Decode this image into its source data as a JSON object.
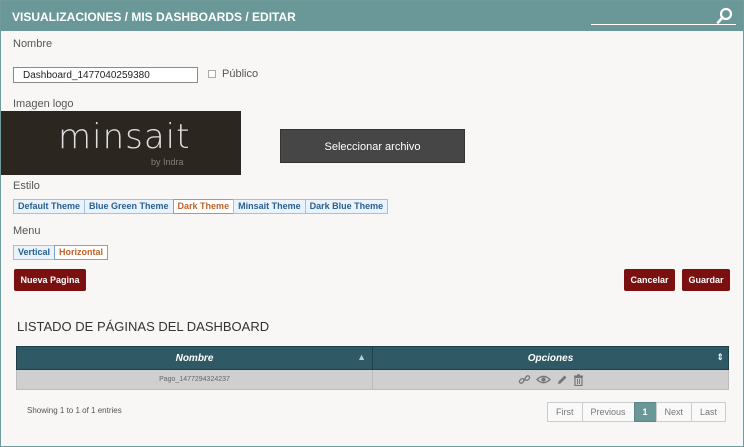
{
  "titlebar": {
    "title": "VISUALIZACIONES / MIS DASHBOARDS / EDITAR",
    "search_placeholder": ""
  },
  "form": {
    "name_label": "Nombre",
    "name_value": "Dashboard_1477040259380",
    "public_label": "Público",
    "logo_label": "Imagen logo",
    "logo_text": "minsait",
    "logo_sub": "by Indra",
    "select_file": "Seleccionar archivo",
    "style_label": "Estilo",
    "themes": [
      "Default Theme",
      "Blue Green Theme",
      "Dark Theme",
      "Minsait Theme",
      "Dark Blue Theme"
    ],
    "selected_theme": "Dark Theme",
    "menu_label": "Menu",
    "menus": [
      "Vertical",
      "Horizontal"
    ],
    "selected_menu": "Horizontal"
  },
  "buttons": {
    "new_page": "Nueva Pagina",
    "cancel": "Cancelar",
    "save": "Guardar"
  },
  "list": {
    "title": "LISTADO DE PÁGINAS DEL DASHBOARD",
    "columns": [
      "Nombre",
      "Opciones"
    ],
    "rows": [
      {
        "name": "Pago_1477294324237"
      }
    ],
    "info": "Showing 1 to 1 of 1 entries",
    "pager": [
      "First",
      "Previous",
      "1",
      "Next",
      "Last"
    ]
  },
  "colors": {
    "header": "#6a9898",
    "accent_red": "#7b1010",
    "table_header": "#2f5964"
  }
}
